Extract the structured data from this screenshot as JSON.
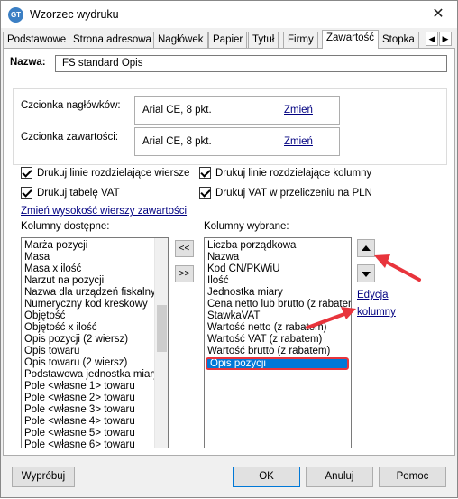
{
  "window": {
    "title": "Wzorzec wydruku",
    "icon_text": "GT"
  },
  "tabs": [
    {
      "label": "Podstawowe"
    },
    {
      "label": "Strona adresowa"
    },
    {
      "label": "Nagłówek"
    },
    {
      "label": "Papier"
    },
    {
      "label": "Tytuł"
    },
    {
      "label": "Firmy"
    },
    {
      "label": "Zawartość",
      "active": true
    },
    {
      "label": "Stopka"
    }
  ],
  "name_field": {
    "label": "Nazwa:",
    "value": "FS standard Opis"
  },
  "fonts": {
    "header": {
      "label": "Czcionka nagłówków:",
      "value": "Arial CE, 8 pkt.",
      "change_link": "Zmień"
    },
    "content": {
      "label": "Czcionka zawartości:",
      "value": "Arial CE, 8 pkt.",
      "change_link": "Zmień"
    }
  },
  "checkboxes": {
    "row_lines": "Drukuj linie rozdzielające wiersze",
    "col_lines": "Drukuj linie rozdzielające kolumny",
    "vat_table": "Drukuj tabelę VAT",
    "vat_pln": "Drukuj VAT w przeliczeniu na PLN"
  },
  "row_height_link": "Zmień wysokość wierszy zawartości",
  "available": {
    "label": "Kolumny dostępne:",
    "items": [
      "Marża pozycji",
      "Masa",
      "Masa x ilość",
      "Narzut na pozycji",
      "Nazwa dla urządzeń fiskalnych",
      "Numeryczny kod kreskowy",
      "Objętość",
      "Objętość x ilość",
      "Opis pozycji (2 wiersz)",
      "Opis towaru",
      "Opis towaru (2 wiersz)",
      "Podstawowa jednostka miary",
      "Pole <własne 1> towaru",
      "Pole <własne 2> towaru",
      "Pole <własne 3> towaru",
      "Pole <własne 4> towaru",
      "Pole <własne 5> towaru",
      "Pole <własne 6> towaru"
    ]
  },
  "move_buttons": {
    "add": "<<",
    "remove": ">>"
  },
  "selected": {
    "label": "Kolumny wybrane:",
    "items": [
      "Liczba porządkowa",
      "Nazwa",
      "Kod CN/PKWiU",
      "Ilość",
      "Jednostka miary",
      "Cena netto lub brutto (z rabatem)",
      "StawkaVAT",
      "Wartość netto (z rabatem)",
      "Wartość VAT (z rabatem)",
      "Wartość brutto (z rabatem)",
      "Opis pozycji"
    ],
    "highlighted_item": "Opis pozycji"
  },
  "edit_link": {
    "line1": "Edycja",
    "line2": "kolumny"
  },
  "footer": {
    "preview": "Wypróbuj",
    "ok": "OK",
    "cancel": "Anuluj",
    "help": "Pomoc"
  },
  "colors": {
    "selection": "#0078d7",
    "annotation": "#e8343c",
    "link": "#000080"
  }
}
